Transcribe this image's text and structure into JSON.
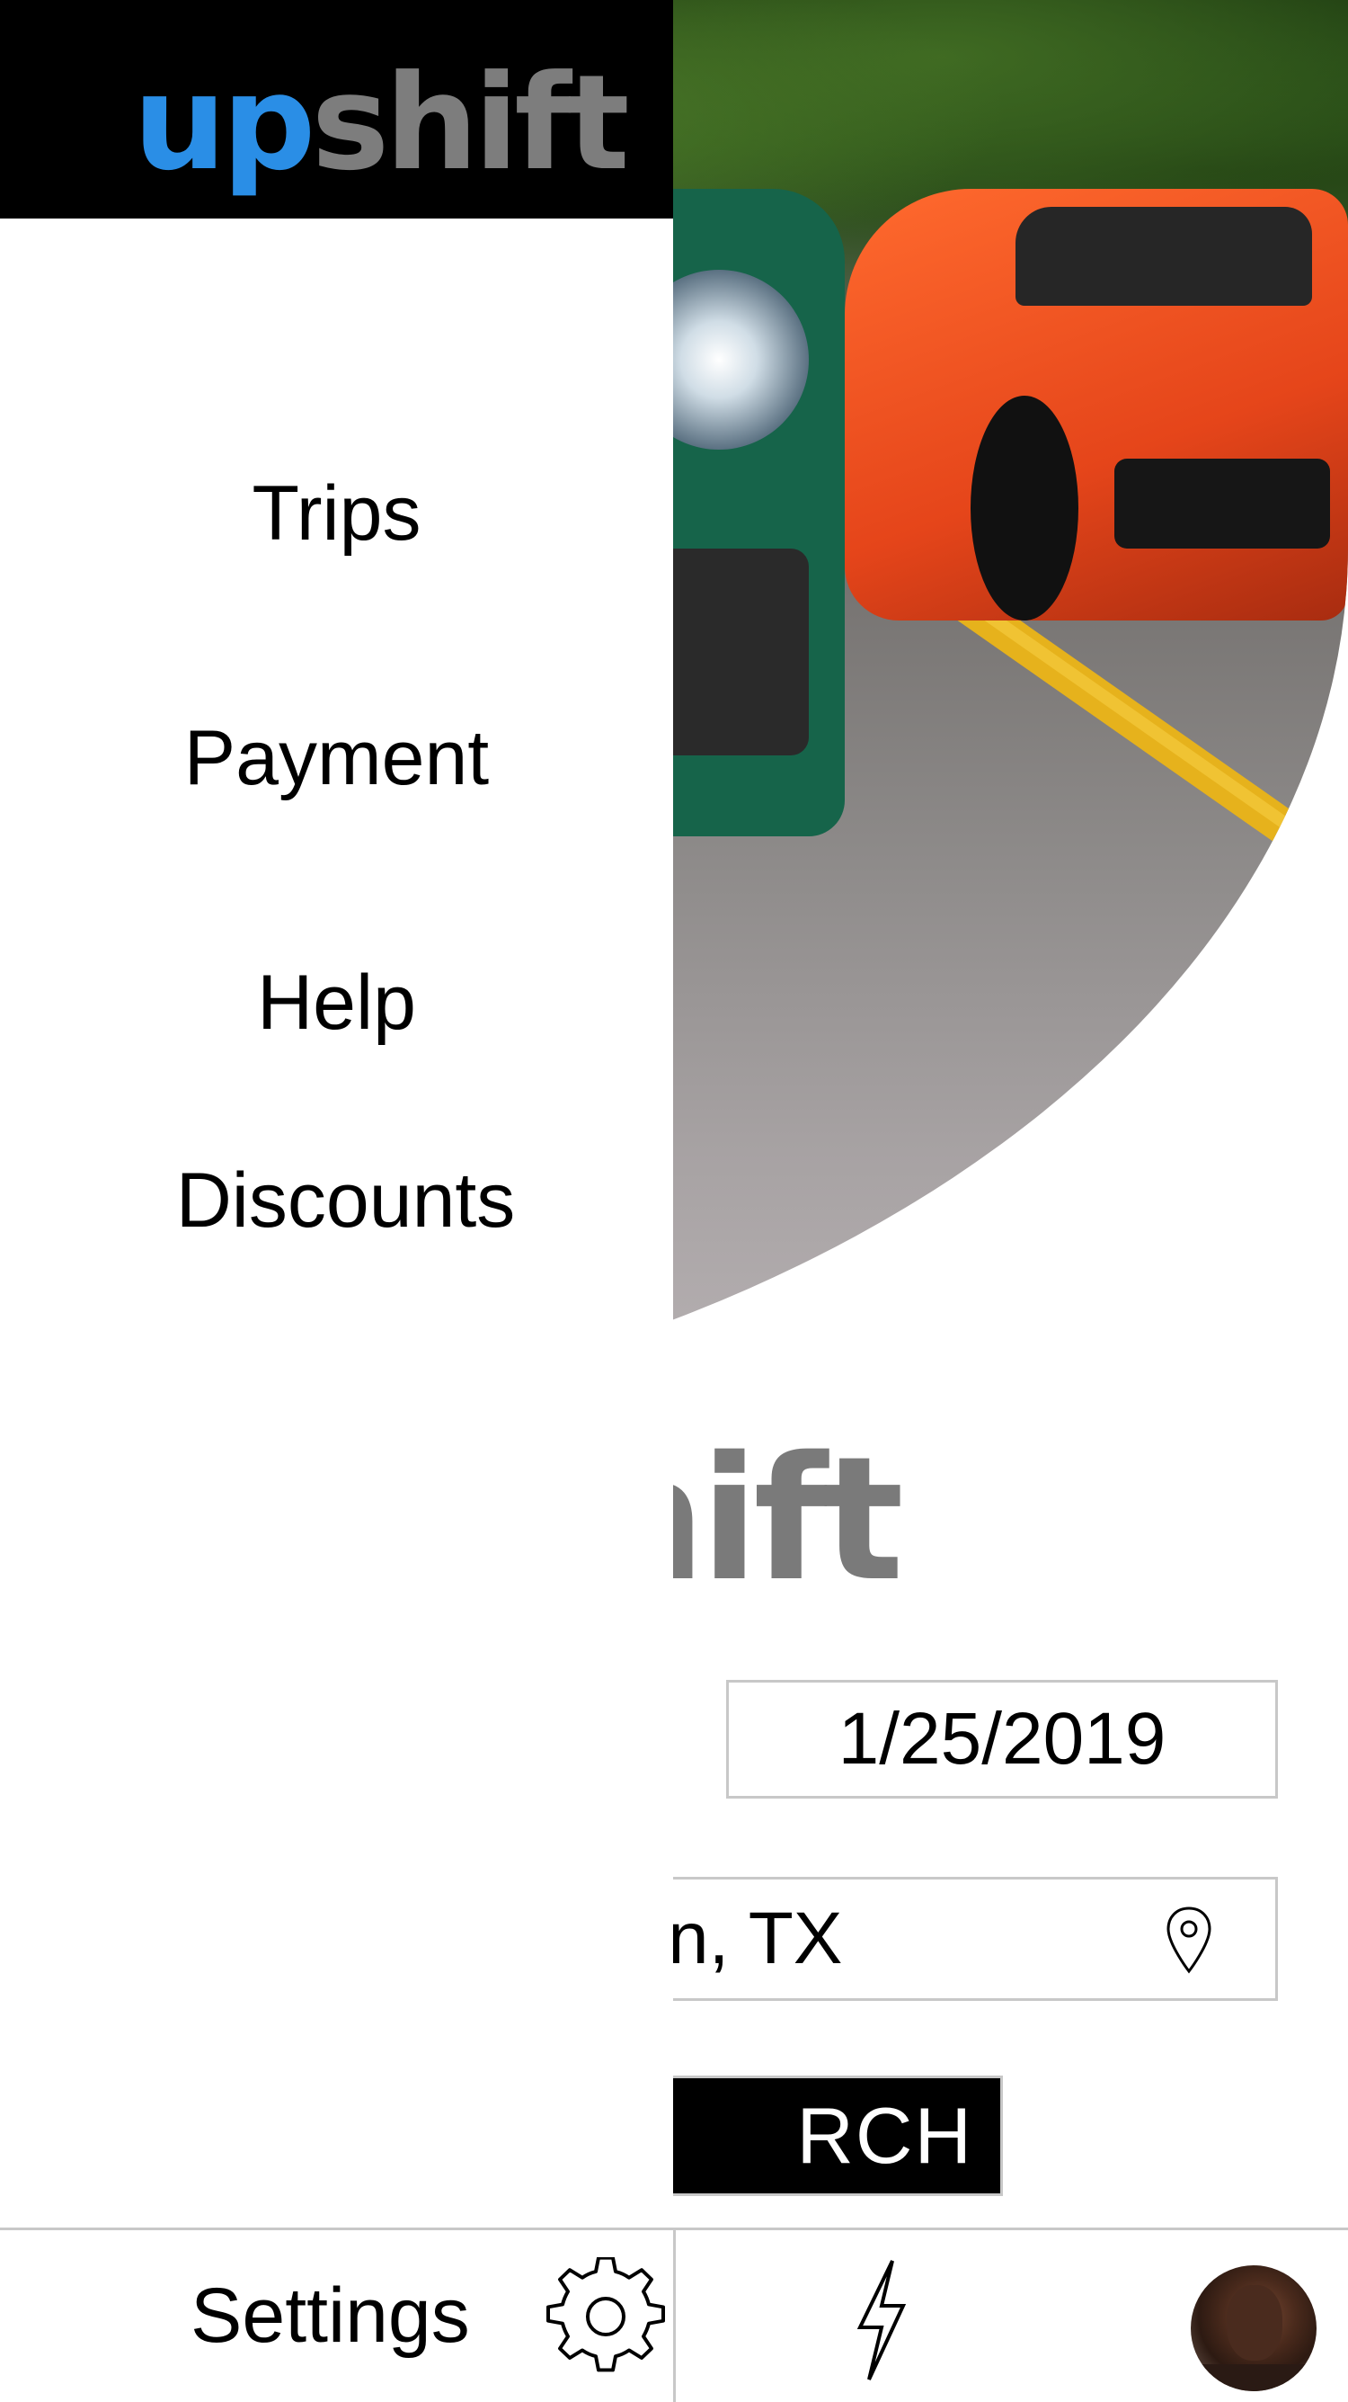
{
  "brand": {
    "logo_up": "up",
    "logo_shift": "shift"
  },
  "background": {
    "logo_visible": "hift",
    "date_value": "1/25/2019",
    "location_value": "n, TX",
    "search_label": "RCH"
  },
  "drawer": {
    "menu": [
      {
        "label": "Trips"
      },
      {
        "label": "Payment"
      },
      {
        "label": "Help"
      },
      {
        "label": "Discounts"
      }
    ],
    "settings_label": "Settings"
  },
  "icons": {
    "settings": "gear-icon",
    "location": "location-pin-icon",
    "quick": "lightning-bolt-icon",
    "profile": "avatar"
  },
  "colors": {
    "brand_blue": "#2a8ee6",
    "brand_gray": "#7d7d7d",
    "header_bg": "#000000",
    "search_bg": "#000000",
    "border": "#c8c8c8"
  }
}
